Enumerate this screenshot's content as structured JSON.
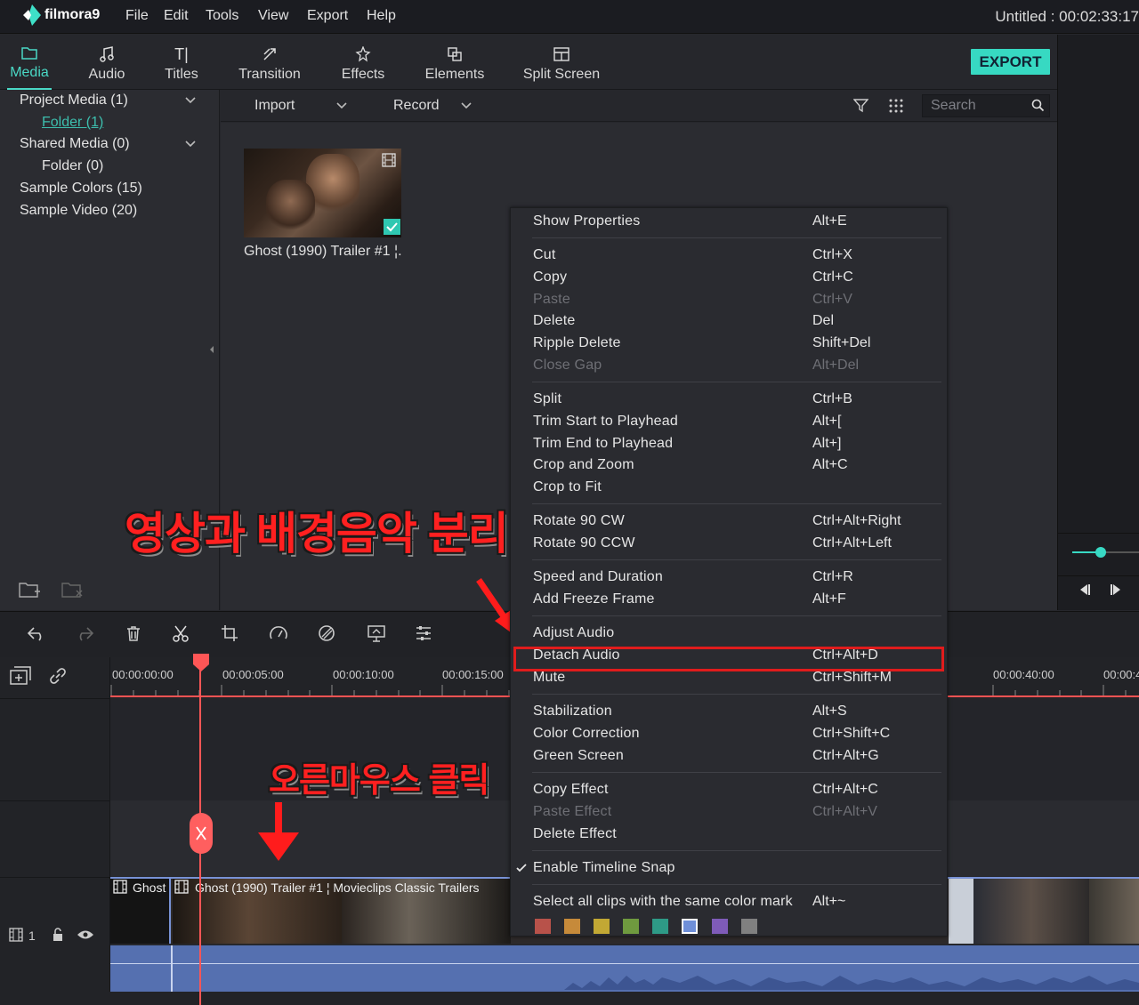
{
  "app": {
    "name": "filmora9",
    "project_title": "Untitled : 00:02:33:17"
  },
  "menubar": [
    "File",
    "Edit",
    "Tools",
    "View",
    "Export",
    "Help"
  ],
  "tabs": [
    {
      "label": "Media",
      "icon": "folder-icon",
      "active": true
    },
    {
      "label": "Audio",
      "icon": "music-note-icon"
    },
    {
      "label": "Titles",
      "icon": "text-icon"
    },
    {
      "label": "Transition",
      "icon": "transition-icon"
    },
    {
      "label": "Effects",
      "icon": "effects-icon"
    },
    {
      "label": "Elements",
      "icon": "elements-icon"
    },
    {
      "label": "Split Screen",
      "icon": "split-screen-icon"
    }
  ],
  "export_label": "EXPORT",
  "library": {
    "project_media": "Project Media (1)",
    "project_folder": "Folder (1)",
    "shared_media": "Shared Media (0)",
    "shared_folder": "Folder (0)",
    "sample_colors": "Sample Colors (15)",
    "sample_video": "Sample Video (20)"
  },
  "media_bar": {
    "import": "Import",
    "record": "Record",
    "search_placeholder": "Search"
  },
  "media_item": {
    "caption": "Ghost (1990) Trailer #1 ¦."
  },
  "annotations": {
    "top": "영상과 배경음악 분리",
    "bottom": "오른마우스 클릭"
  },
  "timeline": {
    "ticks": [
      "00:00:00:00",
      "00:00:05:00",
      "00:00:10:00",
      "00:00:15:00",
      "00:00:40:00",
      "00:00:4"
    ],
    "clip_label_short": "Ghost",
    "clip_label": "Ghost (1990) Trailer #1 ¦ Movieclips Classic Trailers",
    "track_number": "1"
  },
  "context_menu": {
    "items": [
      {
        "label": "Show Properties",
        "shortcut": "Alt+E"
      },
      {
        "label": "Cut",
        "shortcut": "Ctrl+X"
      },
      {
        "label": "Copy",
        "shortcut": "Ctrl+C"
      },
      {
        "label": "Paste",
        "shortcut": "Ctrl+V",
        "disabled": true
      },
      {
        "label": "Delete",
        "shortcut": "Del"
      },
      {
        "label": "Ripple Delete",
        "shortcut": "Shift+Del"
      },
      {
        "label": "Close Gap",
        "shortcut": "Alt+Del",
        "disabled": true
      },
      {
        "label": "Split",
        "shortcut": "Ctrl+B"
      },
      {
        "label": "Trim Start to Playhead",
        "shortcut": "Alt+["
      },
      {
        "label": "Trim End to Playhead",
        "shortcut": "Alt+]"
      },
      {
        "label": "Crop and Zoom",
        "shortcut": "Alt+C"
      },
      {
        "label": "Crop to Fit",
        "shortcut": ""
      },
      {
        "label": "Rotate 90 CW",
        "shortcut": "Ctrl+Alt+Right"
      },
      {
        "label": "Rotate 90 CCW",
        "shortcut": "Ctrl+Alt+Left"
      },
      {
        "label": "Speed and Duration",
        "shortcut": "Ctrl+R"
      },
      {
        "label": "Add Freeze Frame",
        "shortcut": "Alt+F"
      },
      {
        "label": "Adjust Audio",
        "shortcut": ""
      },
      {
        "label": "Detach Audio",
        "shortcut": "Ctrl+Alt+D"
      },
      {
        "label": "Mute",
        "shortcut": "Ctrl+Shift+M"
      },
      {
        "label": "Stabilization",
        "shortcut": "Alt+S"
      },
      {
        "label": "Color Correction",
        "shortcut": "Ctrl+Shift+C"
      },
      {
        "label": "Green Screen",
        "shortcut": "Ctrl+Alt+G"
      },
      {
        "label": "Copy Effect",
        "shortcut": "Ctrl+Alt+C"
      },
      {
        "label": "Paste Effect",
        "shortcut": "Ctrl+Alt+V",
        "disabled": true
      },
      {
        "label": "Delete Effect",
        "shortcut": ""
      },
      {
        "label": "Enable Timeline Snap",
        "shortcut": "",
        "checked": true
      },
      {
        "label": "Select all clips with the same color mark",
        "shortcut": "Alt+~"
      }
    ],
    "color_marks": [
      "#b8524a",
      "#c68a3a",
      "#c2a834",
      "#6f9a3f",
      "#2e9a86",
      "#6f8fd8",
      "#7f5bb8",
      "#808080"
    ]
  }
}
